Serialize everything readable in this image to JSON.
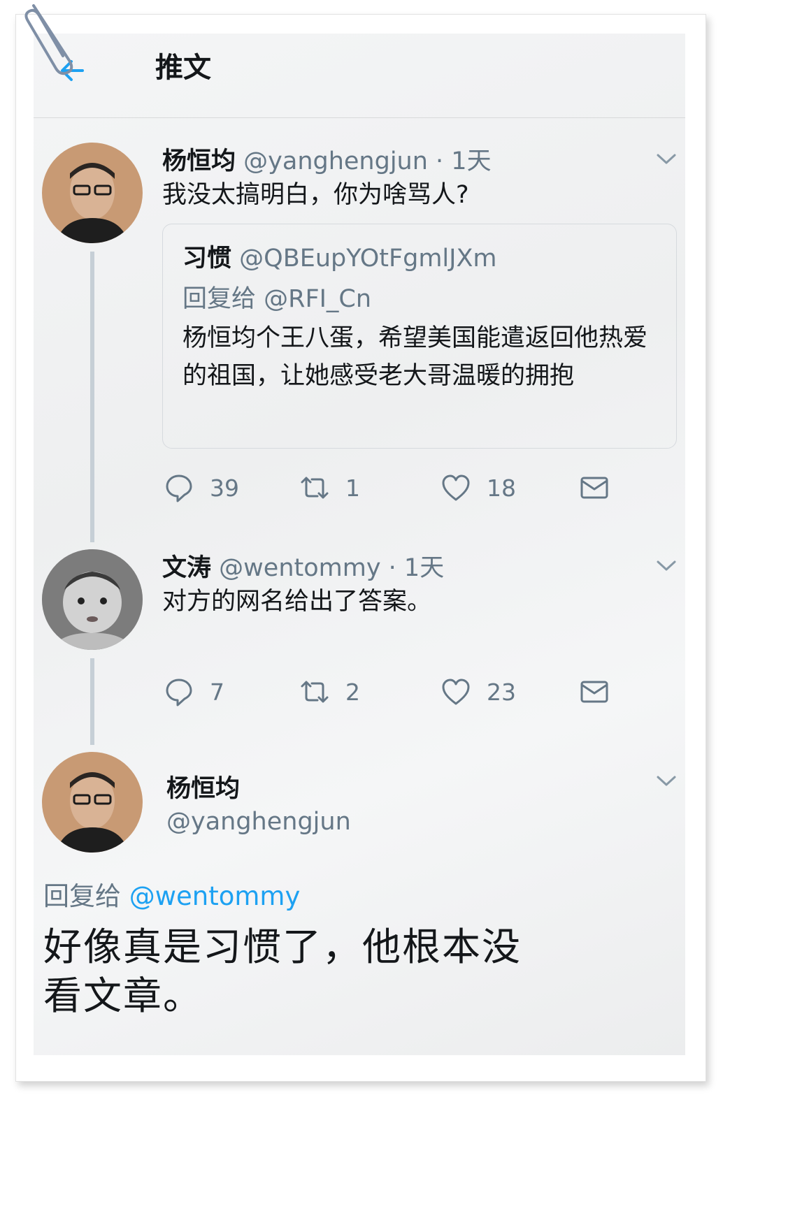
{
  "header": {
    "title": "推文"
  },
  "tweet1": {
    "name": "杨恒均",
    "handle": "@yanghengjun",
    "time": " · 1天",
    "text": "我没太搞明白，你为啥骂人?",
    "quote": {
      "name": "习惯",
      "handle": "@QBEupYOtFgmlJXm",
      "reply_prefix": "回复给",
      "reply_to": "@RFI_Cn",
      "text": "杨恒均个王八蛋，希望美国能遣返回他热爱的祖国，让她感受老大哥温暖的拥抱"
    },
    "actions": {
      "replies": "39",
      "retweets": "1",
      "likes": "18"
    }
  },
  "tweet2": {
    "name": "文涛",
    "handle": "@wentommy",
    "time": " · 1天",
    "text": "对方的网名给出了答案。",
    "actions": {
      "replies": "7",
      "retweets": "2",
      "likes": "23"
    }
  },
  "tweet3": {
    "name": "杨恒均",
    "handle": "@yanghengjun",
    "reply_prefix": "回复给",
    "reply_to": "@wentommy",
    "text": "好像真是习惯了，他根本没看文章。"
  },
  "colors": {
    "accent": "#1da1f2",
    "secondary": "#657786",
    "text": "#14171a"
  },
  "icons": [
    "paperclip-icon",
    "back-arrow-icon",
    "chevron-down-icon",
    "reply-icon",
    "retweet-icon",
    "like-icon",
    "dm-icon"
  ]
}
